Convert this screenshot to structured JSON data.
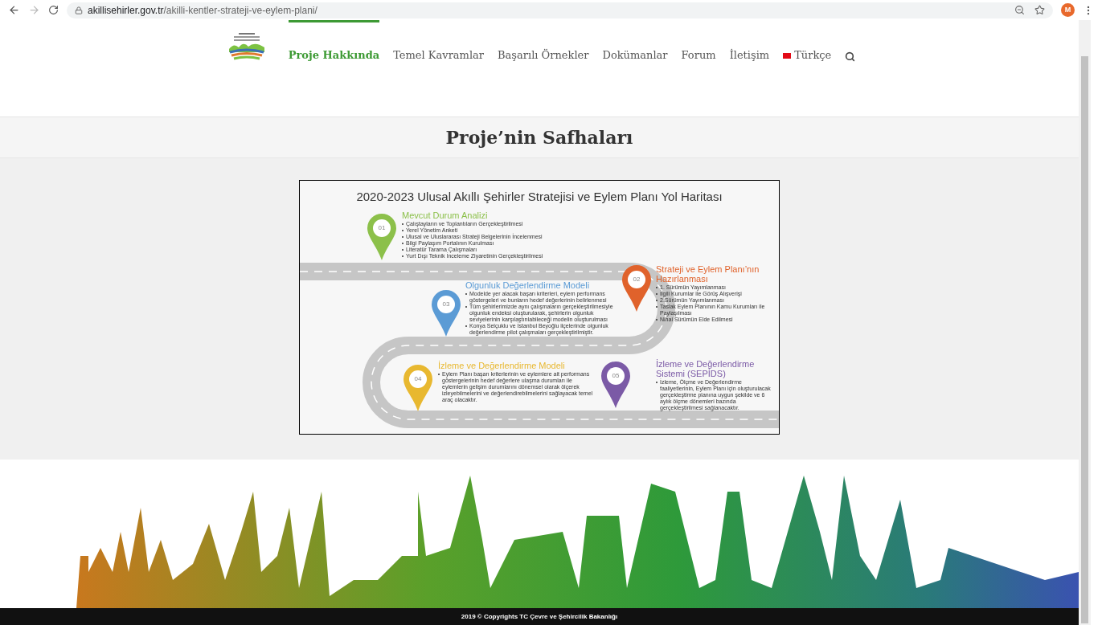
{
  "browser": {
    "url_host": "akillisehirler.gov.tr",
    "url_path": "/akilli-kentler-strateji-ve-eylem-plani/",
    "avatar": "M"
  },
  "nav": {
    "items": [
      {
        "label": "Proje Hakkında",
        "selected": true,
        "kind": "link"
      },
      {
        "label": "Temel Kavramlar",
        "selected": false,
        "kind": "link"
      },
      {
        "label": "Başarılı Örnekler",
        "selected": false,
        "kind": "link"
      },
      {
        "label": "Dokümanlar",
        "selected": false,
        "kind": "link"
      },
      {
        "label": "Forum",
        "selected": false,
        "kind": "link"
      },
      {
        "label": "İletişim",
        "selected": false,
        "kind": "link"
      },
      {
        "label": "Türkçe",
        "selected": false,
        "kind": "language"
      }
    ]
  },
  "page_title": "Proje’nin Safhaları",
  "roadmap": {
    "title": "2020-2023 Ulusal Akıllı Şehirler Stratejisi ve Eylem Planı Yol Haritası",
    "stages": [
      {
        "number": "01",
        "title": "Mevcut Durum Analizi",
        "color": "#8cc04a",
        "bullets": [
          "Çalıştayların ve Toplantıların Gerçekleştirilmesi",
          "Yerel Yönetim Anketi",
          "Ulusal ve Uluslararası Strateji Belgelerinin İncelenmesi",
          "Bilgi Paylaşım Portalının Kurulması",
          "Literatür Tarama Çalışmaları",
          "Yurt Dışı Teknik İnceleme Ziyaretinin Gerçekleştirilmesi"
        ]
      },
      {
        "number": "02",
        "title": "Strateji ve Eylem Planı’nın Hazırlanması",
        "color": "#e0622b",
        "bullets": [
          "1. Sürümün Yayımlanması",
          "İlgili Kurumlar ile Görüş Alışverişi",
          "2.Sürümün Yayımlanması",
          "Taslak Eylem Planının Kamu Kurumları ile Paylaşılması",
          "Nihai Sürümün Elde Edilmesi"
        ]
      },
      {
        "number": "03",
        "title": "Olgunluk Değerlendirme Modeli",
        "color": "#5b9bd5",
        "bullets": [
          "Modelde yer alacak başarı kriterleri, eylem performans göstergeleri ve bunların hedef değerlerinin belirlenmesi",
          "Tüm şehirlerimizde aynı çalışmaların gerçekleştirilmesiyle olgunluk endeksi oluşturularak, şehirlerin olgunluk seviyelerinin karşılaştırılabileceği modelin oluşturulması",
          "Konya Selçuklu ve İstanbul Beyoğlu ilçelerinde olgunluk değerlendirme pilot çalışmaları gerçekleştirilmiştir."
        ]
      },
      {
        "number": "04",
        "title": "İzleme ve Değerlendirme Modeli",
        "color": "#e8b830",
        "bullets": [
          "Eylem Planı başarı kriterlerinin ve eylemlere ait performans göstergelerinin hedef değerlere ulaşma durumları ile eylemlerin gelişim durumlarını dönemsel olarak ölçerek izleyebilmelerini ve değerlendirebilmelerini sağlayacak temel araç olacaktır."
        ]
      },
      {
        "number": "05",
        "title": "İzleme ve Değerlendirme Sistemi (SEPİDS)",
        "color": "#7b5aa6",
        "bullets": [
          "İzleme, Ölçme ve Değerlendirme faaliyetlerinin, Eylem Planı için oluşturulacak gerçekleştirme planına uygun şekilde ve 6 aylık ölçme dönemleri bazında gerçekleştirilmesi sağlanacaktır."
        ]
      }
    ]
  },
  "footer": {
    "copyright": "2019 © Copyrights TC Çevre ve Şehircilik Bakanlığı"
  }
}
